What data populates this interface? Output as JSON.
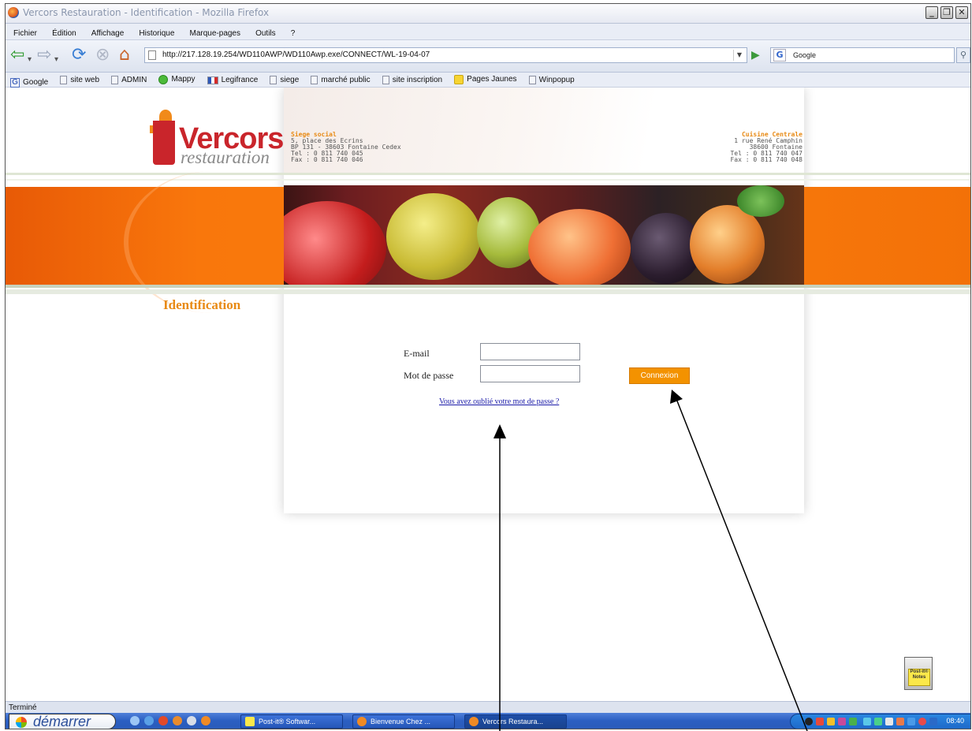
{
  "window": {
    "title": "Vercors Restauration - Identification - Mozilla Firefox",
    "buttons": [
      "minimize",
      "maximize",
      "close"
    ]
  },
  "menu": [
    "Fichier",
    "Édition",
    "Affichage",
    "Historique",
    "Marque-pages",
    "Outils",
    "?"
  ],
  "navigation": {
    "url": "http://217.128.19.254/WD110AWP/WD110Awp.exe/CONNECT/WL-19-04-07",
    "search_engine_label": "Google",
    "search_placeholder": "Google"
  },
  "bookmarks": [
    "Google",
    "site web",
    "ADMIN",
    "Mappy",
    "Legifrance",
    "siege",
    "marché public",
    "site inscription",
    "Pages Jaunes",
    "Winpopup"
  ],
  "site": {
    "logo_line1": "ercors",
    "logo_line1_initial": "V",
    "logo_line2": "restauration",
    "hq": {
      "heading": "Siege social",
      "lines": [
        "5, place des Ecrins",
        "BP 131 - 38603 Fontaine Cedex",
        "Tel :  0 811 740 045",
        "Fax : 0 811 740 046"
      ]
    },
    "kitchen": {
      "heading": "Cuisine Centrale",
      "lines": [
        "1 rue René Camphin",
        "38600 Fontaine",
        "Tel : 0 811 740 047",
        "Fax : 0 811 740 048"
      ]
    },
    "section_title": "Identification"
  },
  "login": {
    "email_label": "E-mail",
    "email_value": "",
    "password_label": "Mot de passe",
    "password_value": "",
    "submit_label": "Connexion",
    "forgot_link": "Vous avez oublié votre mot de passe ?"
  },
  "desktop": {
    "postit_label": "Post-it® Notes"
  },
  "status_text": "Terminé",
  "taskbar": {
    "start_label": "démarrer",
    "tasks": [
      "Post-it® Softwar...",
      "Bienvenue Chez ...",
      "Vercors Restaura..."
    ],
    "clock": "08:40"
  },
  "colors": {
    "accent_orange": "#f39200",
    "brand_red": "#c9252b",
    "link_blue": "#1a1aa8"
  }
}
